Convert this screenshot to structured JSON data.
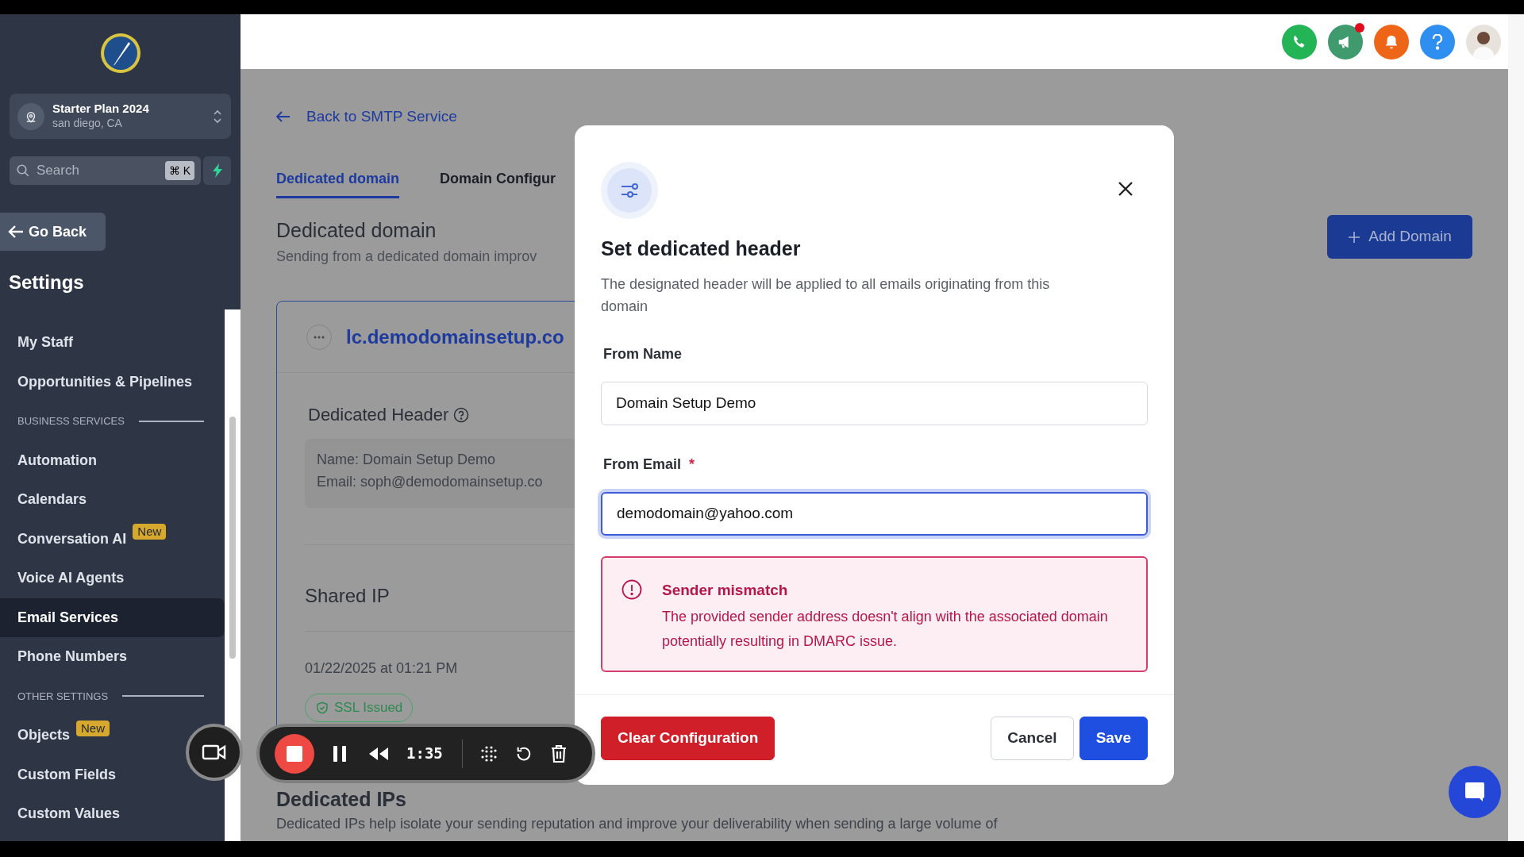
{
  "top_bar": {
    "unread_announcements": true
  },
  "sidebar": {
    "plan": {
      "name": "Starter Plan 2024",
      "location": "san diego, CA"
    },
    "search": {
      "placeholder": "Search",
      "shortcut": "⌘ K"
    },
    "go_back": "Go Back",
    "title": "Settings",
    "items": [
      {
        "kind": "link",
        "label": "My Staff",
        "selected": false
      },
      {
        "kind": "link",
        "label": "Opportunities & Pipelines",
        "selected": false
      },
      {
        "kind": "section",
        "label": "BUSINESS SERVICES"
      },
      {
        "kind": "link",
        "label": "Automation",
        "selected": false
      },
      {
        "kind": "link",
        "label": "Calendars",
        "selected": false
      },
      {
        "kind": "link",
        "label": "Conversation AI",
        "selected": false,
        "badge": "New"
      },
      {
        "kind": "link",
        "label": "Voice AI Agents",
        "selected": false
      },
      {
        "kind": "link",
        "label": "Email Services",
        "selected": true
      },
      {
        "kind": "link",
        "label": "Phone Numbers",
        "selected": false
      },
      {
        "kind": "section",
        "label": "OTHER SETTINGS"
      },
      {
        "kind": "link",
        "label": "Objects",
        "selected": false,
        "badge": "New"
      },
      {
        "kind": "link",
        "label": "Custom Fields",
        "selected": false
      },
      {
        "kind": "link",
        "label": "Custom Values",
        "selected": false
      }
    ]
  },
  "page": {
    "back_link": "Back to SMTP Service",
    "tabs": [
      {
        "label": "Dedicated domain",
        "selected": true
      },
      {
        "label": "Domain Configur",
        "selected": false
      }
    ],
    "title": "Dedicated domain",
    "subtitle": "Sending from a dedicated domain improv",
    "add_button": "Add Domain",
    "domain": {
      "name": "lc.demodomainsetup.co",
      "header_title": "Dedicated Header",
      "header_lines": [
        "Name: Domain Setup Demo",
        "Email: soph@demodomainsetup.co"
      ],
      "ip_title": "Shared IP",
      "date": "01/22/2025 at 01:21 PM",
      "ssl": "SSL Issued"
    },
    "ips_title": "Dedicated IPs",
    "ips_subtitle": "Dedicated IPs help isolate your sending reputation and improve your deliverability when sending a large volume of"
  },
  "modal": {
    "title": "Set dedicated header",
    "description": "The designated header will be applied to all emails originating from this domain",
    "fields": [
      {
        "label": "From Name",
        "value": "Domain Setup Demo",
        "focused": false
      },
      {
        "label": "From Email",
        "value": "demodomain@yahoo.com",
        "required_mark": "*",
        "focused": true
      }
    ],
    "alert": {
      "title": "Sender mismatch",
      "message": "The provided sender address doesn't align with the associated domain potentially resulting in DMARC issue."
    },
    "buttons": [
      {
        "label": "Clear Configuration",
        "kind": "danger"
      },
      {
        "label": "Cancel",
        "kind": "secondary"
      },
      {
        "label": "Save",
        "kind": "primary"
      }
    ]
  },
  "recorder": {
    "time": "1:35"
  }
}
